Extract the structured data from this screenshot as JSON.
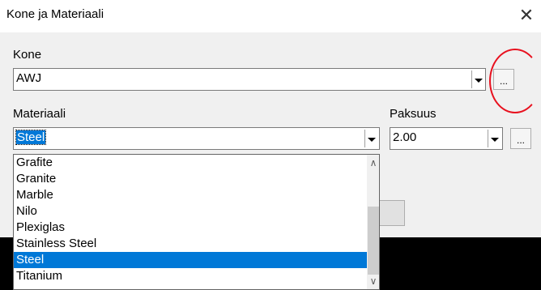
{
  "window": {
    "title": "Kone ja Materiaali",
    "close_icon": "close-icon"
  },
  "kone": {
    "label": "Kone",
    "value": "AWJ",
    "browse_label": "..."
  },
  "materiaali": {
    "label": "Materiaali",
    "value": "Steel",
    "options_visible": [
      "Grafite",
      "Granite",
      "Marble",
      "Nilo",
      "Plexiglas",
      "Stainless Steel",
      "Steel",
      "Titanium"
    ],
    "selected_option": "Steel"
  },
  "paksuus": {
    "label": "Paksuus",
    "value": "2.00",
    "browse_label": "..."
  },
  "colors": {
    "selection": "#0078d7",
    "annotation_circle": "#e8101e"
  }
}
